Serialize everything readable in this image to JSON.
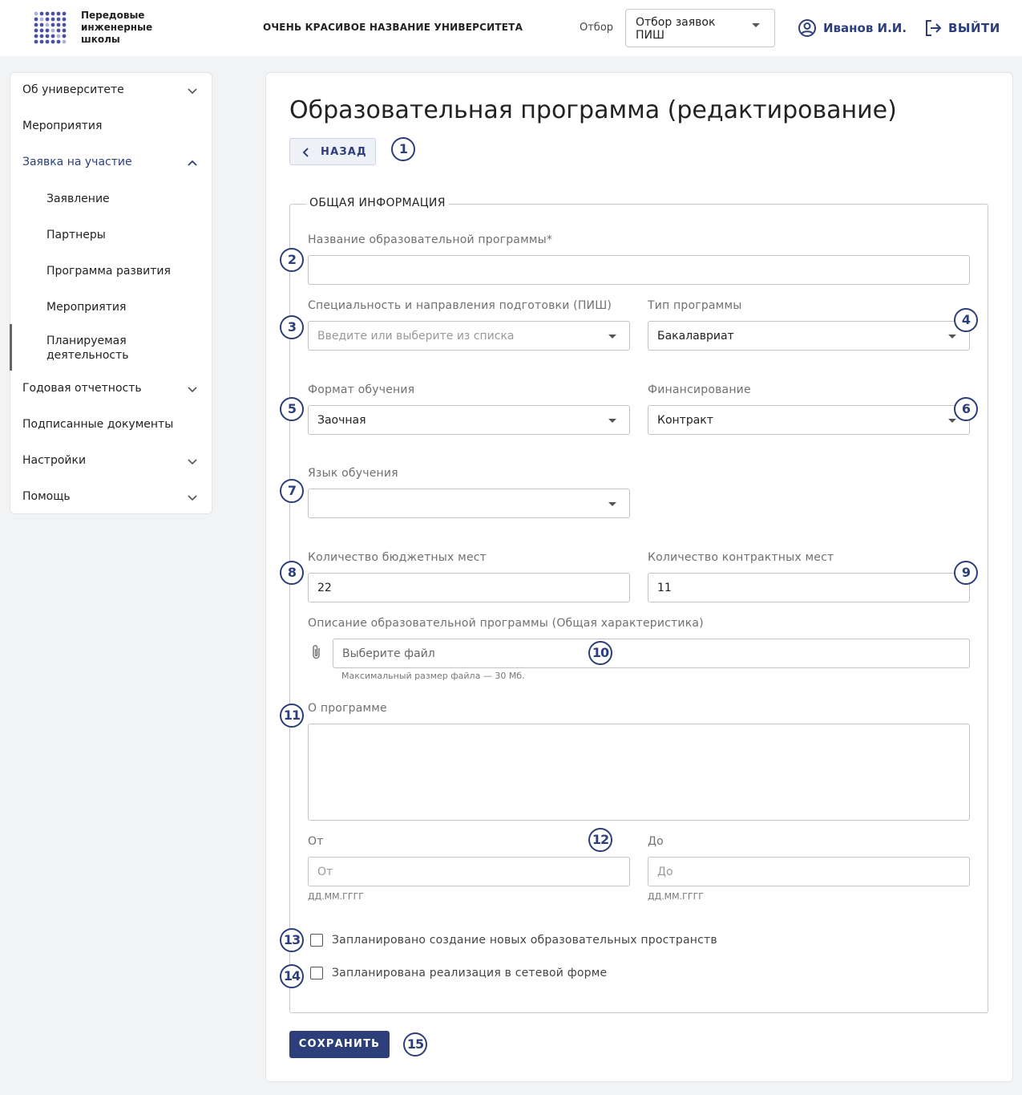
{
  "header": {
    "logo_lines": [
      "Передовые",
      "инженерные",
      "школы"
    ],
    "university_name": "ОЧЕНЬ КРАСИВОЕ НАЗВАНИЕ УНИВЕРСИТЕТА",
    "selection_label": "Отбор",
    "selection_value": "Отбор заявок ПИШ",
    "user_name": "Иванов И.И.",
    "logout_label": "ВЫЙТИ",
    "icons": {
      "user": "user-circle-icon",
      "logout": "logout-icon"
    }
  },
  "sidebar": {
    "items": [
      {
        "label": "Об университете",
        "expandable": true
      },
      {
        "label": "Мероприятия",
        "expandable": false
      },
      {
        "label": "Заявка на участие",
        "expandable": true,
        "expanded": true,
        "active": true
      },
      {
        "label": "Заявление",
        "sub": true
      },
      {
        "label": "Партнеры",
        "sub": true
      },
      {
        "label": "Программа развития",
        "sub": true
      },
      {
        "label": "Мероприятия",
        "sub": true
      },
      {
        "label": "Планируемая деятельность",
        "sub": true,
        "selected": true
      },
      {
        "label": "Годовая отчетность",
        "expandable": true
      },
      {
        "label": "Подписанные документы",
        "expandable": false
      },
      {
        "label": "Настройки",
        "expandable": true
      },
      {
        "label": "Помощь",
        "expandable": true
      }
    ]
  },
  "page": {
    "title": "Образовательная программа (редактирование)",
    "back_label": "НАЗАД",
    "section_title": "ОБЩАЯ ИНФОРМАЦИЯ",
    "fields": {
      "program_name": {
        "label": "Название образовательной программы*",
        "value": ""
      },
      "specialty": {
        "label": "Специальность и направления подготовки (ПИШ)",
        "placeholder": "Введите или выберите из списка"
      },
      "program_type": {
        "label": "Тип программы",
        "value": "Бакалавриат"
      },
      "study_format": {
        "label": "Формат обучения",
        "value": "Заочная"
      },
      "financing": {
        "label": "Финансирование",
        "value": "Контракт"
      },
      "language": {
        "label": "Язык обучения",
        "value": ""
      },
      "budget_places": {
        "label": "Количество бюджетных мест",
        "value": "22"
      },
      "contract_places": {
        "label": "Количество контрактных мест",
        "value": "11"
      },
      "description_file": {
        "label": "Описание образовательной программы (Общая характеристика)",
        "placeholder": "Выберите файл",
        "hint": "Максимальный размер файла — 30 Мб."
      },
      "about": {
        "label": "О программе",
        "value": ""
      },
      "date_from": {
        "label": "От",
        "placeholder": "От",
        "hint": "ДД.ММ.ГГГГ"
      },
      "date_to": {
        "label": "До",
        "placeholder": "До",
        "hint": "ДД.ММ.ГГГГ"
      },
      "new_spaces": {
        "label": "Запланировано создание новых образовательных пространств",
        "checked": false
      },
      "network_form": {
        "label": "Запланирована реализация в сетевой форме",
        "checked": false
      }
    },
    "save_label": "СОХРАНИТЬ"
  },
  "annotations": [
    "1",
    "2",
    "3",
    "4",
    "5",
    "6",
    "7",
    "8",
    "9",
    "10",
    "11",
    "12",
    "13",
    "14",
    "15"
  ],
  "colors": {
    "accent": "#2d3f7a",
    "background": "#f2f3f5",
    "logo_dots": "#4b4fa8"
  }
}
